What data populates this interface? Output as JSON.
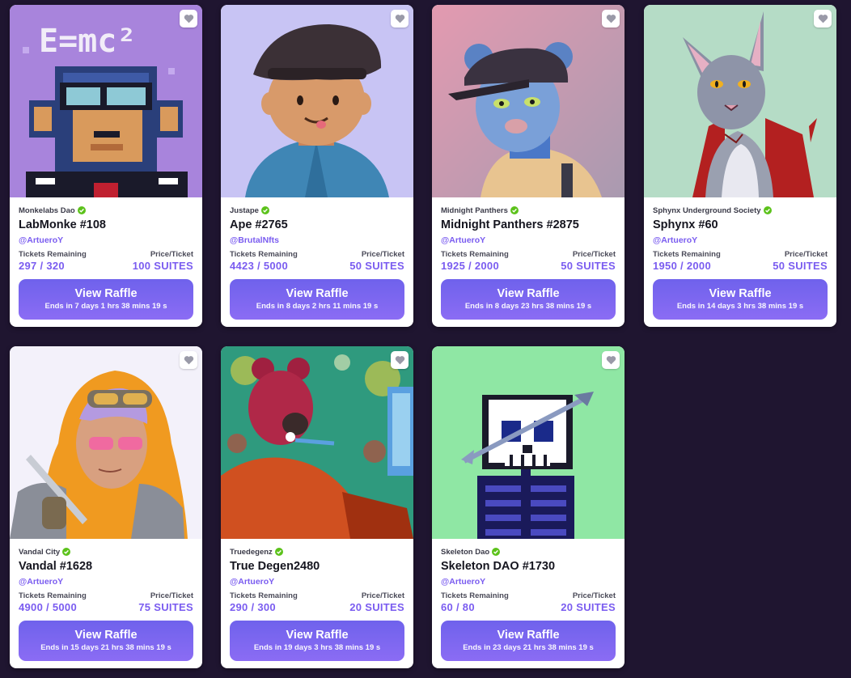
{
  "colors": {
    "background": "#1f1530",
    "accent": "#7a5cf0",
    "button": "#6f62ec",
    "verified": "#5cc21b"
  },
  "icons": {
    "favorite": "heart-icon",
    "verified": "verified-check-icon"
  },
  "raffles": [
    {
      "collection": "Monkelabs Dao",
      "name": "LabMonke #108",
      "owner": "@ArtueroY",
      "tickets_label": "Tickets Remaining",
      "tickets": "297 / 320",
      "price_label": "Price/Ticket",
      "price": "100 SUITES",
      "button": "View Raffle",
      "ends": "Ends in 7 days 1 hrs 38 mins 19 s",
      "art_bg": "#a884dc",
      "art_text": "E=mc²"
    },
    {
      "collection": "Justape",
      "name": "Ape #2765",
      "owner": "@BrutalNfts",
      "tickets_label": "Tickets Remaining",
      "tickets": "4423 / 5000",
      "price_label": "Price/Ticket",
      "price": "50 SUITES",
      "button": "View Raffle",
      "ends": "Ends in 8 days 2 hrs 11 mins 19 s",
      "art_bg": "#c8c4f4"
    },
    {
      "collection": "Midnight Panthers",
      "name": "Midnight Panthers #2875",
      "owner": "@ArtueroY",
      "tickets_label": "Tickets Remaining",
      "tickets": "1925 / 2000",
      "price_label": "Price/Ticket",
      "price": "50 SUITES",
      "button": "View Raffle",
      "ends": "Ends in 8 days 23 hrs 38 mins 19 s",
      "art_bg": "#c99aa8"
    },
    {
      "collection": "Sphynx Underground Society",
      "name": "Sphynx #60",
      "owner": "@ArtueroY",
      "tickets_label": "Tickets Remaining",
      "tickets": "1950 / 2000",
      "price_label": "Price/Ticket",
      "price": "50 SUITES",
      "button": "View Raffle",
      "ends": "Ends in 14 days 3 hrs 38 mins 19 s",
      "art_bg": "#b5dcc6"
    },
    {
      "collection": "Vandal City",
      "name": "Vandal #1628",
      "owner": "@ArtueroY",
      "tickets_label": "Tickets Remaining",
      "tickets": "4900 / 5000",
      "price_label": "Price/Ticket",
      "price": "75 SUITES",
      "button": "View Raffle",
      "ends": "Ends in 15 days 21 hrs 38 mins 19 s",
      "art_bg": "#f3f1fa"
    },
    {
      "collection": "Truedegenz",
      "name": "True Degen2480",
      "owner": "@ArtueroY",
      "tickets_label": "Tickets Remaining",
      "tickets": "290 / 300",
      "price_label": "Price/Ticket",
      "price": "20 SUITES",
      "button": "View Raffle",
      "ends": "Ends in 19 days 3 hrs 38 mins 19 s",
      "art_bg": "#2f9a7e"
    },
    {
      "collection": "Skeleton Dao",
      "name": "Skeleton DAO #1730",
      "owner": "@ArtueroY",
      "tickets_label": "Tickets Remaining",
      "tickets": "60 / 80",
      "price_label": "Price/Ticket",
      "price": "20 SUITES",
      "button": "View Raffle",
      "ends": "Ends in 23 days 21 hrs 38 mins 19 s",
      "art_bg": "#8fe7a4"
    }
  ]
}
